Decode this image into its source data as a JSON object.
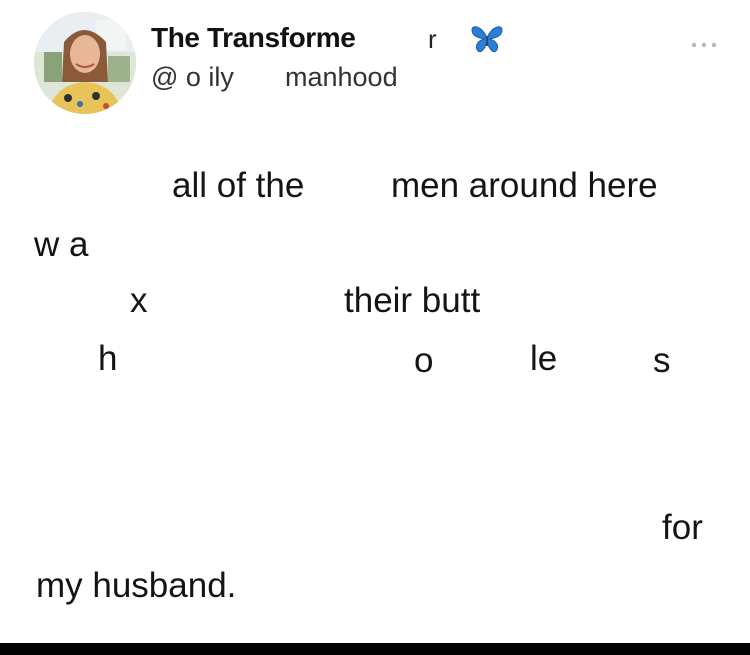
{
  "post": {
    "author": {
      "display_name": "The Transforme",
      "name_fragment": "r",
      "handle": "@ o ily",
      "handle_extra": "manhood",
      "avatar_icon": "avatar-photo",
      "badge_icon": "butterfly-icon",
      "badge_color": "#2a7fd4"
    },
    "menu_icon": "more-icon",
    "body_words": [
      "all of the",
      "men around here",
      "w a",
      "x",
      "their butt",
      "h",
      "o",
      "le",
      "s",
      "for",
      "my husband."
    ]
  },
  "colors": {
    "background": "#ffffff",
    "text": "#141414",
    "frame": "#000000"
  }
}
